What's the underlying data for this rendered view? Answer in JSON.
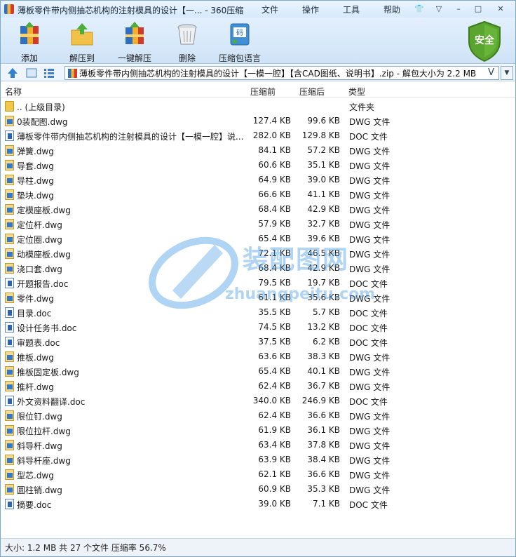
{
  "window": {
    "title": "薄板零件带内侧抽芯机构的注射模具的设计【一...  - 360压缩",
    "menu": [
      "文件",
      "操作",
      "工具",
      "帮助"
    ],
    "controls": {
      "skin": "👕",
      "menu": "▽",
      "minimize": "–",
      "maximize": "□",
      "close": "✕"
    }
  },
  "toolbar": {
    "items": [
      {
        "label": "添加",
        "icon": "add-archive-icon"
      },
      {
        "label": "解压到",
        "icon": "extract-to-icon"
      },
      {
        "label": "一键解压",
        "icon": "one-click-extract-icon"
      },
      {
        "label": "删除",
        "icon": "delete-bin-icon"
      },
      {
        "label": "压缩包语言",
        "icon": "archive-language-icon"
      }
    ],
    "security_label": "安全",
    "security_color": "#5aa530"
  },
  "address": {
    "value": "薄板零件带内侧抽芯机构的注射模具的设计【一模一腔】【含CAD图纸、说明书】.zip - 解包大小为 2.2 MB",
    "v_glyph": "V"
  },
  "columns": [
    "名称",
    "压缩前",
    "压缩后",
    "类型"
  ],
  "files": [
    {
      "name": ".. (上级目录)",
      "csize": "",
      "osize": "",
      "type": "文件夹",
      "kind": "folder"
    },
    {
      "name": "0装配图.dwg",
      "csize": "127.4 KB",
      "osize": "99.6 KB",
      "type": "DWG 文件",
      "kind": "dwg"
    },
    {
      "name": "薄板零件带内侧抽芯机构的注射模具的设计【一模一腔】说...",
      "csize": "282.0 KB",
      "osize": "129.8 KB",
      "type": "DOC 文件",
      "kind": "doc"
    },
    {
      "name": "弹簧.dwg",
      "csize": "84.1 KB",
      "osize": "57.2 KB",
      "type": "DWG 文件",
      "kind": "dwg"
    },
    {
      "name": "导套.dwg",
      "csize": "60.6 KB",
      "osize": "35.1 KB",
      "type": "DWG 文件",
      "kind": "dwg"
    },
    {
      "name": "导柱.dwg",
      "csize": "64.9 KB",
      "osize": "39.0 KB",
      "type": "DWG 文件",
      "kind": "dwg"
    },
    {
      "name": "垫块.dwg",
      "csize": "66.6 KB",
      "osize": "41.1 KB",
      "type": "DWG 文件",
      "kind": "dwg"
    },
    {
      "name": "定模座板.dwg",
      "csize": "68.4 KB",
      "osize": "42.9 KB",
      "type": "DWG 文件",
      "kind": "dwg"
    },
    {
      "name": "定位杆.dwg",
      "csize": "57.9 KB",
      "osize": "32.7 KB",
      "type": "DWG 文件",
      "kind": "dwg"
    },
    {
      "name": "定位圈.dwg",
      "csize": "65.4 KB",
      "osize": "39.6 KB",
      "type": "DWG 文件",
      "kind": "dwg"
    },
    {
      "name": "动模座板.dwg",
      "csize": "72.1 KB",
      "osize": "46.5 KB",
      "type": "DWG 文件",
      "kind": "dwg"
    },
    {
      "name": "浇口套.dwg",
      "csize": "68.4 KB",
      "osize": "42.9 KB",
      "type": "DWG 文件",
      "kind": "dwg"
    },
    {
      "name": "开题报告.doc",
      "csize": "79.5 KB",
      "osize": "19.7 KB",
      "type": "DOC 文件",
      "kind": "doc"
    },
    {
      "name": "零件.dwg",
      "csize": "61.1 KB",
      "osize": "35.6 KB",
      "type": "DWG 文件",
      "kind": "dwg"
    },
    {
      "name": "目录.doc",
      "csize": "35.5 KB",
      "osize": "5.7 KB",
      "type": "DOC 文件",
      "kind": "doc"
    },
    {
      "name": "设计任务书.doc",
      "csize": "74.5 KB",
      "osize": "13.2 KB",
      "type": "DOC 文件",
      "kind": "doc"
    },
    {
      "name": "审题表.doc",
      "csize": "37.5 KB",
      "osize": "6.2 KB",
      "type": "DOC 文件",
      "kind": "doc"
    },
    {
      "name": "推板.dwg",
      "csize": "63.6 KB",
      "osize": "38.3 KB",
      "type": "DWG 文件",
      "kind": "dwg"
    },
    {
      "name": "推板固定板.dwg",
      "csize": "65.4 KB",
      "osize": "40.1 KB",
      "type": "DWG 文件",
      "kind": "dwg"
    },
    {
      "name": "推杆.dwg",
      "csize": "62.4 KB",
      "osize": "36.7 KB",
      "type": "DWG 文件",
      "kind": "dwg"
    },
    {
      "name": "外文资料翻译.doc",
      "csize": "340.0 KB",
      "osize": "246.9 KB",
      "type": "DOC 文件",
      "kind": "doc"
    },
    {
      "name": "限位钉.dwg",
      "csize": "62.4 KB",
      "osize": "36.6 KB",
      "type": "DWG 文件",
      "kind": "dwg"
    },
    {
      "name": "限位拉杆.dwg",
      "csize": "61.9 KB",
      "osize": "36.1 KB",
      "type": "DWG 文件",
      "kind": "dwg"
    },
    {
      "name": "斜导杆.dwg",
      "csize": "63.4 KB",
      "osize": "37.8 KB",
      "type": "DWG 文件",
      "kind": "dwg"
    },
    {
      "name": "斜导杆座.dwg",
      "csize": "63.9 KB",
      "osize": "38.4 KB",
      "type": "DWG 文件",
      "kind": "dwg"
    },
    {
      "name": "型芯.dwg",
      "csize": "62.1 KB",
      "osize": "36.6 KB",
      "type": "DWG 文件",
      "kind": "dwg"
    },
    {
      "name": "圆柱销.dwg",
      "csize": "60.9 KB",
      "osize": "35.3 KB",
      "type": "DWG 文件",
      "kind": "dwg"
    },
    {
      "name": "摘要.doc",
      "csize": "39.0 KB",
      "osize": "7.1 KB",
      "type": "DOC 文件",
      "kind": "doc"
    }
  ],
  "watermark": {
    "cn": "装配图网",
    "en": "zhuangpeitu.com"
  },
  "status": "大小: 1.2 MB 共 27 个文件 压缩率 56.7%"
}
